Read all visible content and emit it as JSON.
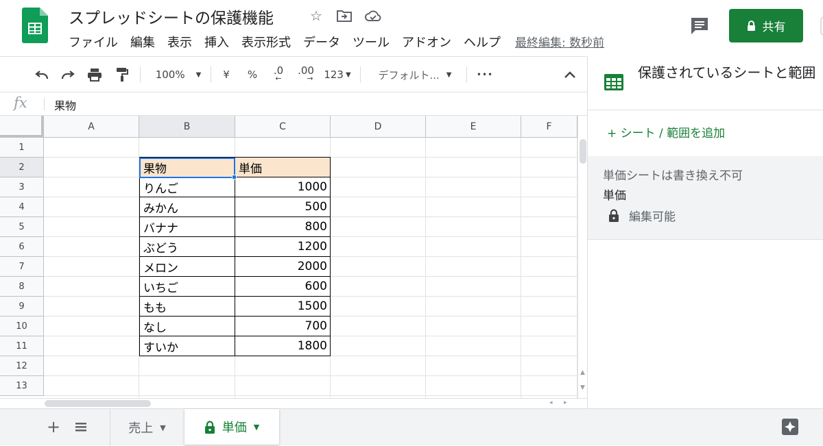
{
  "header": {
    "title": "スプレッドシートの保護機能",
    "menu": [
      "ファイル",
      "編集",
      "表示",
      "挿入",
      "表示形式",
      "データ",
      "ツール",
      "アドオン",
      "ヘルプ"
    ],
    "last_edit": "最終編集: 数秒前",
    "share_label": "共有"
  },
  "toolbar": {
    "zoom": "100%",
    "currency": "¥",
    "percent": "%",
    "dec_decrease": ".0",
    "dec_increase": ".00",
    "number_format": "123",
    "font": "デフォルト...",
    "more": "•••"
  },
  "formula_bar": {
    "fx": "fx",
    "value": "果物"
  },
  "grid": {
    "columns": [
      "A",
      "B",
      "C",
      "D",
      "E",
      "F"
    ],
    "selected_column": "B",
    "rows": [
      "1",
      "2",
      "3",
      "4",
      "5",
      "6",
      "7",
      "8",
      "9",
      "10",
      "11",
      "12",
      "13"
    ],
    "selected_row": "2",
    "table_header": {
      "name": "果物",
      "price": "単価"
    },
    "table_rows": [
      {
        "name": "りんご",
        "price": "1000"
      },
      {
        "name": "みかん",
        "price": "500"
      },
      {
        "name": "バナナ",
        "price": "800"
      },
      {
        "name": "ぶどう",
        "price": "1200"
      },
      {
        "name": "メロン",
        "price": "2000"
      },
      {
        "name": "いちご",
        "price": "600"
      },
      {
        "name": "もも",
        "price": "1500"
      },
      {
        "name": "なし",
        "price": "700"
      },
      {
        "name": "すいか",
        "price": "1800"
      }
    ],
    "header_fill": "#fce5cd",
    "selection_color": "#1a73e8"
  },
  "side_panel": {
    "title": "保護されているシートと範囲",
    "add_label": "+ シート / 範囲を追加",
    "item": {
      "description": "単価シートは書き換え不可",
      "name": "単価",
      "permission": "編集可能"
    }
  },
  "sheets": {
    "tabs": [
      {
        "label": "売上",
        "active": false
      },
      {
        "label": "単価",
        "active": true,
        "locked": true
      }
    ]
  },
  "colors": {
    "brand_green": "#188038",
    "share_bg": "#188038"
  }
}
